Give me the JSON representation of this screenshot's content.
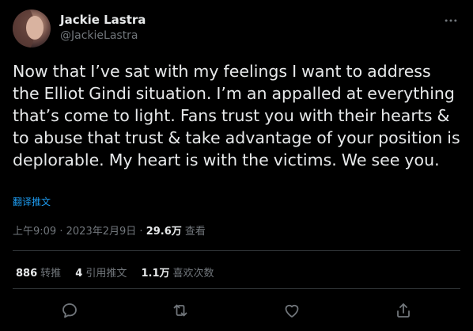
{
  "tweet": {
    "author": {
      "display_name": "Jackie Lastra",
      "handle": "@JackieLastra"
    },
    "text": "Now that I’ve sat with my feelings I want to address the Elliot Gindi situation. I’m an appalled at everything that’s come to light. Fans trust you with their hearts & to abuse that trust & take advantage of your position is deplorable. My heart is with the victims. We see you.",
    "translate_link": "翻译推文",
    "time": "上午9:09",
    "date": "2023年2月9日",
    "separator": "·",
    "views_count": "29.6万",
    "views_label": "查看"
  },
  "stats": {
    "retweets_count": "886",
    "retweets_label": "转推",
    "quotes_count": "4",
    "quotes_label": "引用推文",
    "likes_count": "1.1万",
    "likes_label": "喜欢次数"
  },
  "actions": [
    "reply-icon",
    "retweet-icon",
    "like-icon",
    "share-icon"
  ],
  "colors": {
    "background": "#000000",
    "text": "#e7e9ea",
    "secondary": "#71767b",
    "link": "#1d9bf0",
    "divider": "#2f3336"
  }
}
